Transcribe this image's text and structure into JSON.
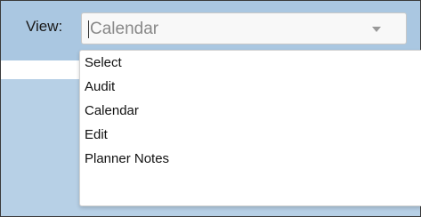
{
  "view_field": {
    "label": "View:",
    "selected_value": "Calendar",
    "caret_icon": "chevron-down-icon"
  },
  "dropdown": {
    "options": [
      {
        "label": "Select"
      },
      {
        "label": "Audit"
      },
      {
        "label": "Calendar"
      },
      {
        "label": "Edit"
      },
      {
        "label": "Planner Notes"
      }
    ]
  },
  "colors": {
    "background": "#b9d1e6",
    "select_bg": "#f8f8f8",
    "selected_text": "#888888"
  }
}
